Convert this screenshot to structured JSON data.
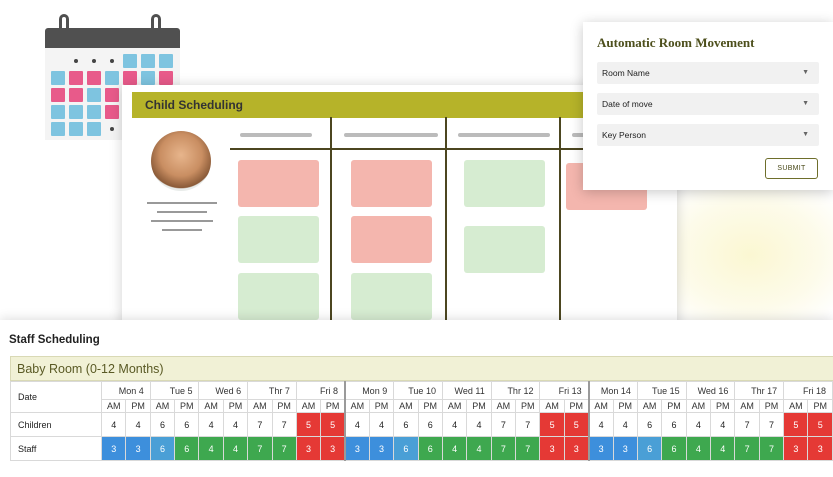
{
  "child_scheduling": {
    "title": "Child Scheduling"
  },
  "automatic_room_movement": {
    "title": "Automatic Room Movement",
    "fields": [
      {
        "label": "Room Name"
      },
      {
        "label": "Date of move"
      },
      {
        "label": "Key Person"
      }
    ],
    "submit_label": "SUBMIT"
  },
  "staff_scheduling": {
    "title": "Staff Scheduling",
    "room_name": "Baby Room (0-12 Months)",
    "row_labels": {
      "date": "Date",
      "children": "Children",
      "staff": "Staff"
    },
    "am": "AM",
    "pm": "PM",
    "days": [
      {
        "day": "Mon 4",
        "children": [
          4,
          4
        ],
        "staff": [
          3,
          3
        ],
        "staff_color": "blue"
      },
      {
        "day": "Tue 5",
        "children": [
          6,
          6
        ],
        "staff": [
          6,
          6
        ],
        "staff_color": "mixed"
      },
      {
        "day": "Wed 6",
        "children": [
          4,
          4
        ],
        "staff": [
          4,
          4
        ],
        "staff_color": "green"
      },
      {
        "day": "Thr 7",
        "children": [
          7,
          7
        ],
        "staff": [
          7,
          7
        ],
        "staff_color": "green"
      },
      {
        "day": "Fri 8",
        "children": [
          5,
          5
        ],
        "staff": [
          3,
          3
        ],
        "staff_color": "red"
      },
      {
        "day": "Mon 9",
        "children": [
          4,
          4
        ],
        "staff": [
          3,
          3
        ],
        "staff_color": "blue"
      },
      {
        "day": "Tue 10",
        "children": [
          6,
          6
        ],
        "staff": [
          6,
          6
        ],
        "staff_color": "mixed"
      },
      {
        "day": "Wed 11",
        "children": [
          4,
          4
        ],
        "staff": [
          4,
          4
        ],
        "staff_color": "green"
      },
      {
        "day": "Thr 12",
        "children": [
          7,
          7
        ],
        "staff": [
          7,
          7
        ],
        "staff_color": "green"
      },
      {
        "day": "Fri 13",
        "children": [
          5,
          5
        ],
        "staff": [
          3,
          3
        ],
        "staff_color": "red"
      },
      {
        "day": "Mon 14",
        "children": [
          4,
          4
        ],
        "staff": [
          3,
          3
        ],
        "staff_color": "blue"
      },
      {
        "day": "Tue 15",
        "children": [
          6,
          6
        ],
        "staff": [
          6,
          6
        ],
        "staff_color": "mixed"
      },
      {
        "day": "Wed 16",
        "children": [
          4,
          4
        ],
        "staff": [
          4,
          4
        ],
        "staff_color": "green"
      },
      {
        "day": "Thr 17",
        "children": [
          7,
          7
        ],
        "staff": [
          7,
          7
        ],
        "staff_color": "green"
      },
      {
        "day": "Fri 18",
        "children": [
          5,
          5
        ],
        "staff": [
          3,
          3
        ],
        "staff_color": "red"
      }
    ]
  },
  "colors": {
    "accent": "#b6b329",
    "alert_red": "#e53935",
    "staff_blue": "#3d8fdc",
    "staff_green": "#3ea84f"
  },
  "icons": {
    "calendar": "calendar-icon",
    "dropdown": "chevron-down-icon",
    "avatar": "avatar"
  }
}
